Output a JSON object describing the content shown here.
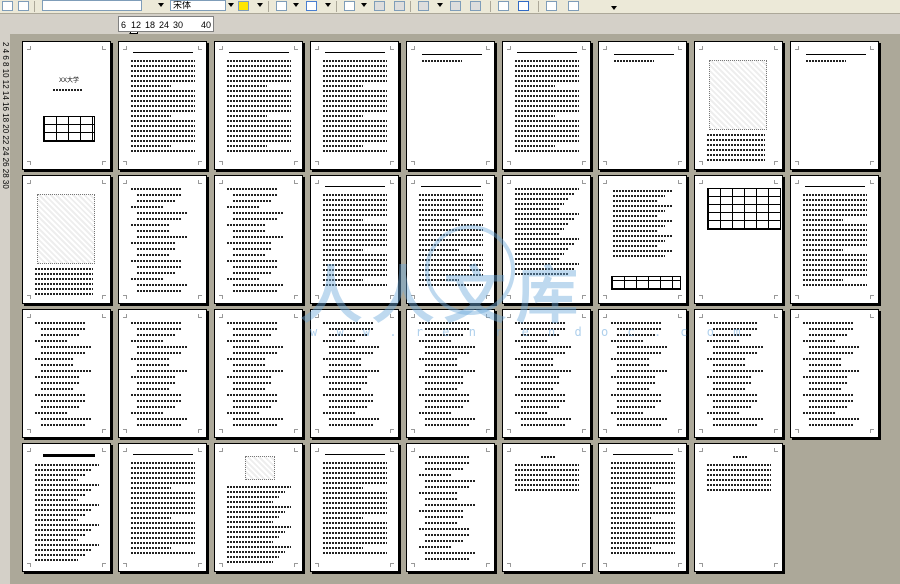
{
  "toolbar": {
    "font_name": "",
    "font_size": "",
    "font_extra": "宋体",
    "icons": [
      "new-icon",
      "properties-icon",
      "font-combo",
      "font-size-combo",
      "font-color-icon",
      "borders-icon",
      "link-icon",
      "table-icon",
      "insert-columns-icon",
      "align-icon",
      "distribute-icon",
      "show-hide-icon",
      "grid-icon",
      "sort-az-icon",
      "sort-za-icon",
      "toolbar-overflow-icon"
    ]
  },
  "ruler": {
    "lead": "6",
    "labels": [
      "6",
      "12",
      "18",
      "24",
      "30",
      "40"
    ],
    "vertical": "2 4 6 8 10 12 14 16 18 20 22 24 26 28 30"
  },
  "watermark": {
    "text": "人人文库",
    "url": "w w w . r e n r e n d o c . c o m"
  },
  "pages": [
    {
      "title": "XX大学"
    },
    {
      "title": ""
    },
    {
      "title": ""
    },
    {
      "title": ""
    },
    {
      "title": ""
    },
    {
      "title": ""
    },
    {
      "title": ""
    },
    {
      "title": ""
    },
    {
      "title": ""
    },
    {
      "title": ""
    },
    {
      "title": ""
    },
    {
      "title": ""
    },
    {
      "title": ""
    },
    {
      "title": ""
    },
    {
      "title": ""
    },
    {
      "title": ""
    },
    {
      "title": ""
    },
    {
      "title": ""
    },
    {
      "title": ""
    },
    {
      "title": ""
    },
    {
      "title": ""
    },
    {
      "title": ""
    },
    {
      "title": ""
    },
    {
      "title": ""
    },
    {
      "title": ""
    },
    {
      "title": ""
    },
    {
      "title": ""
    },
    {
      "title": ""
    },
    {
      "title": ""
    },
    {
      "title": ""
    },
    {
      "title": ""
    },
    {
      "title": ""
    },
    {
      "title": ""
    },
    {
      "title": ""
    },
    {
      "title": ""
    }
  ]
}
